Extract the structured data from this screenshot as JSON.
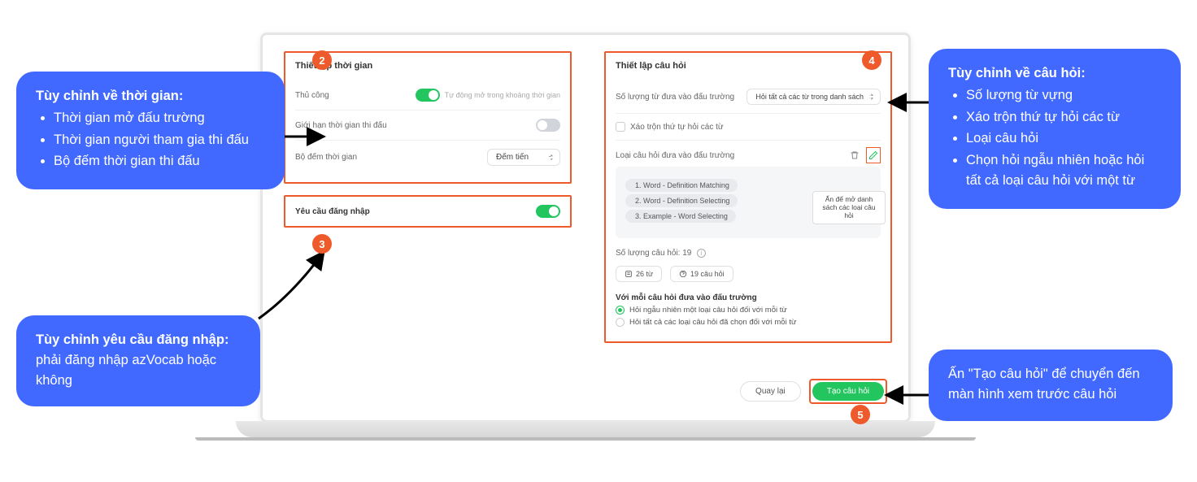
{
  "badges": {
    "b2": "2",
    "b3": "3",
    "b4": "4",
    "b5": "5"
  },
  "left": {
    "section_title": "Thiết lập thời gian",
    "manual_label": "Thủ công",
    "manual_hint": "Tự động mở trong khoảng thời gian",
    "limit_label": "Giới hạn thời gian thi đấu",
    "timer_label": "Bộ đếm thời gian",
    "timer_value": "Đếm tiến",
    "login_label": "Yêu cầu đăng nhập"
  },
  "right": {
    "section_title": "Thiết lập câu hỏi",
    "word_count_label": "Số lượng từ đưa vào đấu trường",
    "word_count_value": "Hỏi tất cả các từ trong danh sách",
    "shuffle_label": "Xáo trộn thứ tự hỏi các từ",
    "qtype_label": "Loại câu hỏi đưa vào đấu trường",
    "qtypes": [
      "1. Word - Definition Matching",
      "2. Word - Definition Selecting",
      "3. Example - Word Selecting"
    ],
    "qcount_label": "Số lượng câu hỏi: 19",
    "pill_words": "26 từ",
    "pill_questions": "19 câu hỏi",
    "strategy_label": "Với mỗi câu hỏi đưa vào đấu trường",
    "radio1": "Hỏi ngẫu nhiên một loại câu hỏi đối với mỗi từ",
    "radio2": "Hỏi tất cả các loại câu hỏi đã chọn đối với mỗi từ",
    "tooltip": "Ấn để mở danh sách các loại câu hỏi"
  },
  "footer": {
    "back": "Quay lại",
    "create": "Tạo câu hỏi"
  },
  "callouts": {
    "c2_title": "Tùy chỉnh về thời gian:",
    "c2_items": [
      "Thời gian mở đấu trường",
      "Thời gian người tham gia thi đấu",
      "Bộ đếm thời gian thi đấu"
    ],
    "c3_strong": "Tùy chỉnh yêu cầu đăng nhập:",
    "c3_rest": " phải đăng nhập azVocab hoặc không",
    "c4_title": "Tùy chỉnh về câu hỏi:",
    "c4_items": [
      "Số lượng từ vựng",
      "Xáo trộn thứ tự hỏi các từ",
      "Loại câu hỏi",
      "Chọn hỏi ngẫu nhiên hoặc hỏi tất cả loại câu hỏi với một từ"
    ],
    "c5": "Ấn \"Tạo câu hỏi\" để chuyển đến màn hình xem trước câu hỏi"
  }
}
